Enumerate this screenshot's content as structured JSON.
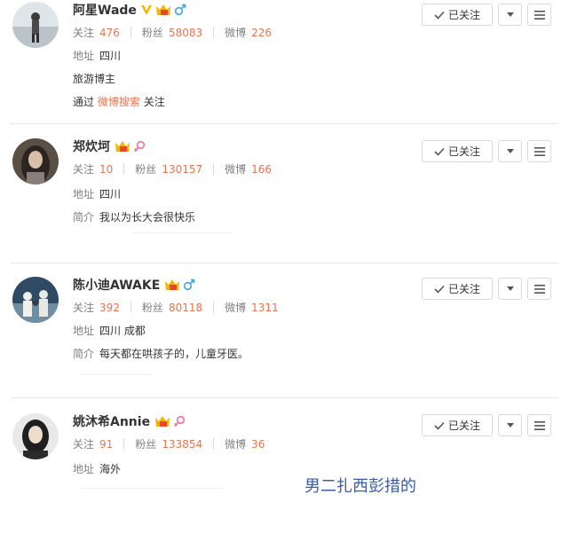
{
  "users": [
    {
      "name": "阿星Wade",
      "verified": true,
      "gender": "male",
      "follow_label": "关注",
      "follow_count": "476",
      "fans_label": "粉丝",
      "fans_count": "58083",
      "weibo_label": "微博",
      "weibo_count": "226",
      "location_label": "地址",
      "location": "四川",
      "extra_line": "旅游博主",
      "via_prefix": "通过",
      "via_link": "微博搜索",
      "via_suffix": "关注",
      "button_label": "已关注"
    },
    {
      "name": "郑炊坷",
      "verified": false,
      "gender": "female",
      "follow_label": "关注",
      "follow_count": "10",
      "fans_label": "粉丝",
      "fans_count": "130157",
      "weibo_label": "微博",
      "weibo_count": "166",
      "location_label": "地址",
      "location": "四川",
      "bio_label": "简介",
      "bio": "我以为长大会很快乐",
      "button_label": "已关注"
    },
    {
      "name": "陈小迪AWAKE",
      "verified": false,
      "gender": "male",
      "follow_label": "关注",
      "follow_count": "392",
      "fans_label": "粉丝",
      "fans_count": "80118",
      "weibo_label": "微博",
      "weibo_count": "1311",
      "location_label": "地址",
      "location": "四川 成都",
      "bio_label": "简介",
      "bio": "每天都在哄孩子的，儿童牙医。",
      "button_label": "已关注"
    },
    {
      "name": "姚沐希Annie",
      "verified": false,
      "gender": "female",
      "follow_label": "关注",
      "follow_count": "91",
      "fans_label": "粉丝",
      "fans_count": "133854",
      "weibo_label": "微博",
      "weibo_count": "36",
      "location_label": "地址",
      "location": "海外",
      "button_label": "已关注"
    }
  ],
  "caption": "男二扎西彭措的",
  "colors": {
    "accent": "#eb7350",
    "male": "#3fa5e8",
    "female": "#f36fa1",
    "verified": "#f8b500",
    "caption": "#3a5ba5"
  }
}
